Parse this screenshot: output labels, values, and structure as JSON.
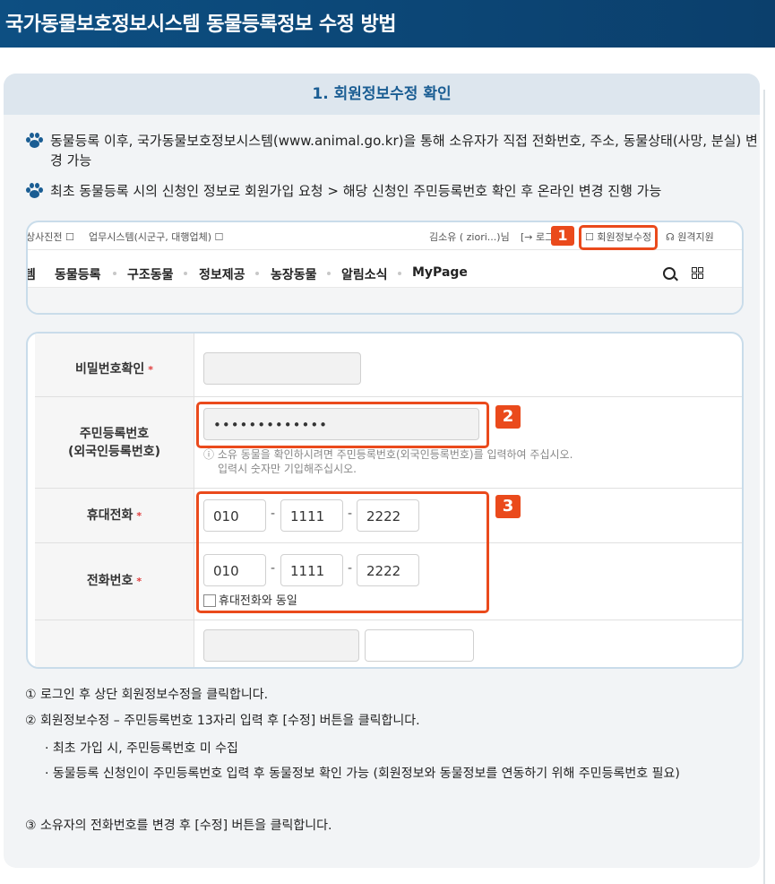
{
  "header": {
    "title": "국가동물보호정보시스템 동물등록정보 수정 방법"
  },
  "section": {
    "title": "1. 회원정보수정 확인"
  },
  "bullets": [
    "동물등록 이후, 국가동물보호정보시스템(www.animal.go.kr)을 통해 소유자가 직접 전화번호, 주소, 동물상태(사망, 분실) 변경 가능",
    "최초 동물등록 시의 신청인 정보로 회원가입 요청 > 해당 신청인 주민등록번호 확인 후 온라인 변경 진행 가능"
  ],
  "site_topnav": {
    "link1": "상사진전 ☐",
    "link2": "업무시스템(시군구, 대행업체) ☐",
    "user": "김소유 ( ziori...)님",
    "logout": "[→ 로그아",
    "edit_profile": "☐ 회원정보수정",
    "remote": "☊ 원격지원"
  },
  "site_menu": [
    "템",
    "동물등록",
    "구조동물",
    "정보제공",
    "농장동물",
    "알림소식",
    "MyPage"
  ],
  "tags": [
    "1",
    "2",
    "3"
  ],
  "form": {
    "password_confirm_label": "비밀번호확인",
    "required_mark": "*",
    "resident_label_1": "주민등록번호",
    "resident_label_2": "(외국인등록번호)",
    "resident_value": "•••••••••••••",
    "resident_hint_1": "ⓘ 소유 동물을 확인하시려면 주민등록번호(외국인등록번호)를 입력하여 주십시오.",
    "resident_hint_2": "입력시 숫자만 기입해주십시오.",
    "mobile_label": "휴대전화",
    "mobile": [
      "010",
      "1111",
      "2222"
    ],
    "phone_label": "전화번호",
    "phone": [
      "010",
      "1111",
      "2222"
    ],
    "dash": "-",
    "same_as_mobile": "휴대전화와 동일"
  },
  "steps": {
    "s1": "① 로그인 후 상단 회원정보수정을 클릭합니다.",
    "s2": "② 회원정보수정 – 주민등록번호 13자리 입력 후 [수정] 버튼을 클릭합니다.",
    "s2_sub1": "· 최초 가입 시, 주민등록번호 미 수집",
    "s2_sub2": "· 동물등록 신청인이 주민등록번호 입력 후 동물정보 확인 가능 (회원정보와 동물정보를 연동하기 위해 주민등록번호 필요)",
    "s3": "③ 소유자의 전화번호를 변경 후 [수정] 버튼을 클릭합니다."
  },
  "colors": {
    "header_bg": "#0d4f82",
    "accent": "#1a5d93",
    "highlight": "#ea4a1c"
  }
}
